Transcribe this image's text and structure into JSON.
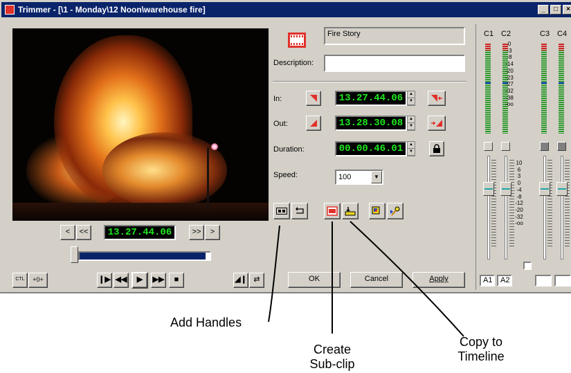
{
  "window": {
    "title": "Trimmer - [\\1 - Monday\\12 Noon\\warehouse fire]"
  },
  "clip": {
    "name": "Fire Story",
    "description_label": "Description:",
    "description_value": ""
  },
  "in": {
    "label": "In:",
    "timecode": "13.27.44.06"
  },
  "out": {
    "label": "Out:",
    "timecode": "13.28.30.08"
  },
  "duration": {
    "label": "Duration:",
    "timecode": "00.00.46.01"
  },
  "speed": {
    "label": "Speed:",
    "value": "100"
  },
  "player": {
    "timecode": "13.27.44.06",
    "scrub_fraction": 0.97,
    "ctl": "CTL",
    "to_zero": "+0+"
  },
  "buttons": {
    "ok": "OK",
    "cancel": "Cancel",
    "apply": "Apply"
  },
  "mixer": {
    "channels": [
      "C1",
      "C2",
      "C3",
      "C4"
    ],
    "meter_scale": [
      "0",
      "-3",
      "-8",
      "-14",
      "-20",
      "-23",
      "-27",
      "-32",
      "-38",
      "-oo"
    ],
    "fader_scale": [
      "10",
      "6",
      "3",
      "0",
      "-4",
      "-8",
      "-12",
      "-20",
      "-32",
      "-oo"
    ],
    "outputs": [
      "A1",
      "A2",
      "",
      ""
    ]
  },
  "annotations": {
    "add_handles": "Add Handles",
    "create_subclip_1": "Create",
    "create_subclip_2": "Sub-clip",
    "copy_timeline_1": "Copy to",
    "copy_timeline_2": "Timeline"
  },
  "colors": {
    "titlebar": "#0a246a",
    "lcd_text": "#1ee81e",
    "accent_red": "#e0302a"
  }
}
